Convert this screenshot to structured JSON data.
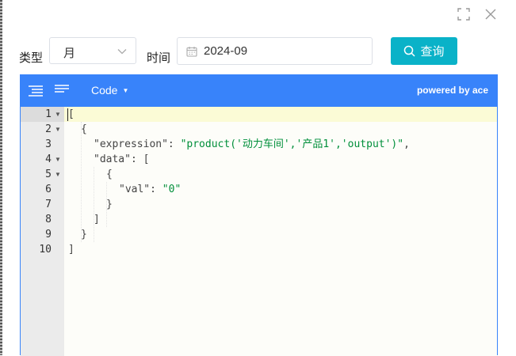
{
  "window": {
    "maximize_icon": "maximize-icon",
    "close_icon": "close-icon"
  },
  "filters": {
    "type_label": "类型",
    "type_value": "月",
    "time_label": "时间",
    "date_value": "2024-09",
    "query_label": "查询"
  },
  "editor": {
    "mode_label": "Code",
    "powered_by": "powered by ace",
    "line_numbers": [
      "1",
      "2",
      "3",
      "4",
      "5",
      "6",
      "7",
      "8",
      "9",
      "10"
    ],
    "lines": {
      "l1": "[",
      "l2": "{",
      "key_expression": "\"expression\"",
      "val_expression": "\"product('动力车间','产品1','output')\"",
      "l3_tail": ",",
      "key_data": "\"data\"",
      "l4_tail": "[",
      "l5": "{",
      "key_val": "\"val\"",
      "val_val": "\"0\"",
      "l7": "}",
      "l8": "]",
      "l9": "}",
      "l10": "]",
      "colon": ": "
    }
  },
  "colors": {
    "accent": "#3883fa",
    "query_button": "#0ab2c8",
    "string": "#008f3a",
    "active_line": "#fbfbd6"
  }
}
